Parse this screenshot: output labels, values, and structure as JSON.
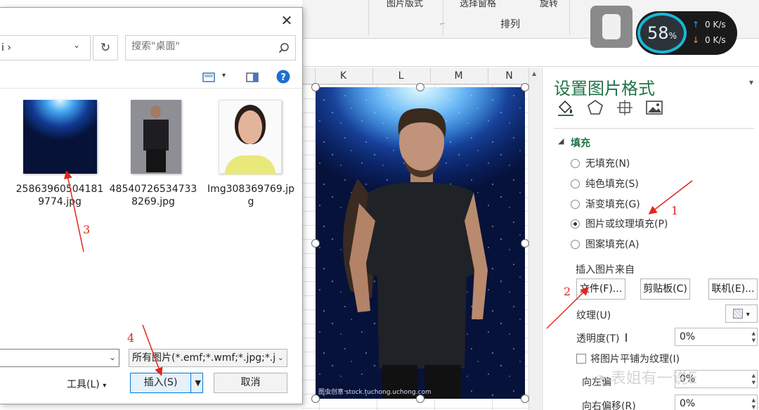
{
  "ribbon": {
    "picture_layout_label": "图片版式",
    "selection_pane_label": "选择窗格",
    "rotate_label": "旋转",
    "arrange_group_label": "排列"
  },
  "columns": [
    "K",
    "L",
    "M",
    "N"
  ],
  "format_pane": {
    "title": "设置图片格式",
    "fill_section": "填充",
    "fill_options": [
      {
        "label": "无填充(N)",
        "checked": false
      },
      {
        "label": "纯色填充(S)",
        "checked": false
      },
      {
        "label": "渐变填充(G)",
        "checked": false
      },
      {
        "label": "图片或纹理填充(P)",
        "checked": true
      },
      {
        "label": "图案填充(A)",
        "checked": false
      }
    ],
    "insert_from_label": "插入图片来自",
    "file_button": "文件(F)...",
    "clipboard_button": "剪贴板(C)",
    "online_button": "联机(E)...",
    "texture_label": "纹理(U)",
    "transparency_label": "透明度(T)",
    "transparency_value": "0%",
    "tile_label": "将图片平铺为纹理(I)",
    "offset_left_label": "向左偏",
    "offset_left_value": "0%",
    "offset_right_label": "向右偏移(R)",
    "offset_right_value": "0%"
  },
  "speed_widget": {
    "percent": "58",
    "percent_sign": "%",
    "upload": "0 K/s",
    "download": "0 K/s"
  },
  "dialog": {
    "address_tail": "i",
    "search_placeholder": "搜索\"桌面\"",
    "files": [
      {
        "name": "258639605041819774.jpg"
      },
      {
        "name": "485407265347338269.jpg"
      },
      {
        "name": "Img308369769.jpg"
      }
    ],
    "filename_value": "",
    "filetype": "所有图片(*.emf;*.wmf;*.jpg;*.jp",
    "tools_label": "工具(L)",
    "insert_button": "插入(S)",
    "cancel_button": "取消"
  },
  "picture": {
    "watermark": "图虫创意 stock.tuchong.uchong.com"
  },
  "annotations": {
    "steps": [
      "1",
      "2",
      "3",
      "4"
    ],
    "color": "#e1261c"
  },
  "brand_watermark": "表姐有一说E"
}
